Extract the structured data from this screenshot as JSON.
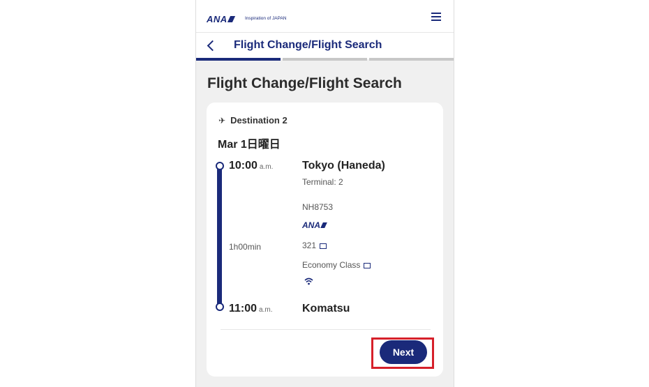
{
  "header": {
    "logo_text": "ANA",
    "tagline": "Inspiration of JAPAN"
  },
  "titlebar": {
    "title": "Flight Change/Flight Search"
  },
  "progress": {
    "steps_total": 3,
    "active_step": 1
  },
  "page": {
    "title": "Flight Change/Flight Search"
  },
  "flight": {
    "destination_label": "Destination 2",
    "date": "Mar 1日曜日",
    "departure": {
      "time": "10:00",
      "ampm": "a.m.",
      "city": "Tokyo (Haneda)",
      "terminal": "Terminal: 2"
    },
    "flight_number": "NH8753",
    "airline_logo": "ANA",
    "duration": "1h00min",
    "aircraft": "321",
    "cabin": "Economy Class",
    "wifi_icon": "wifi-icon",
    "arrival": {
      "time": "11:00",
      "ampm": "a.m.",
      "city": "Komatsu"
    }
  },
  "actions": {
    "next_label": "Next"
  },
  "colors": {
    "brand": "#1a2a7a",
    "highlight": "#d6202a",
    "background": "#f0f0f0"
  }
}
